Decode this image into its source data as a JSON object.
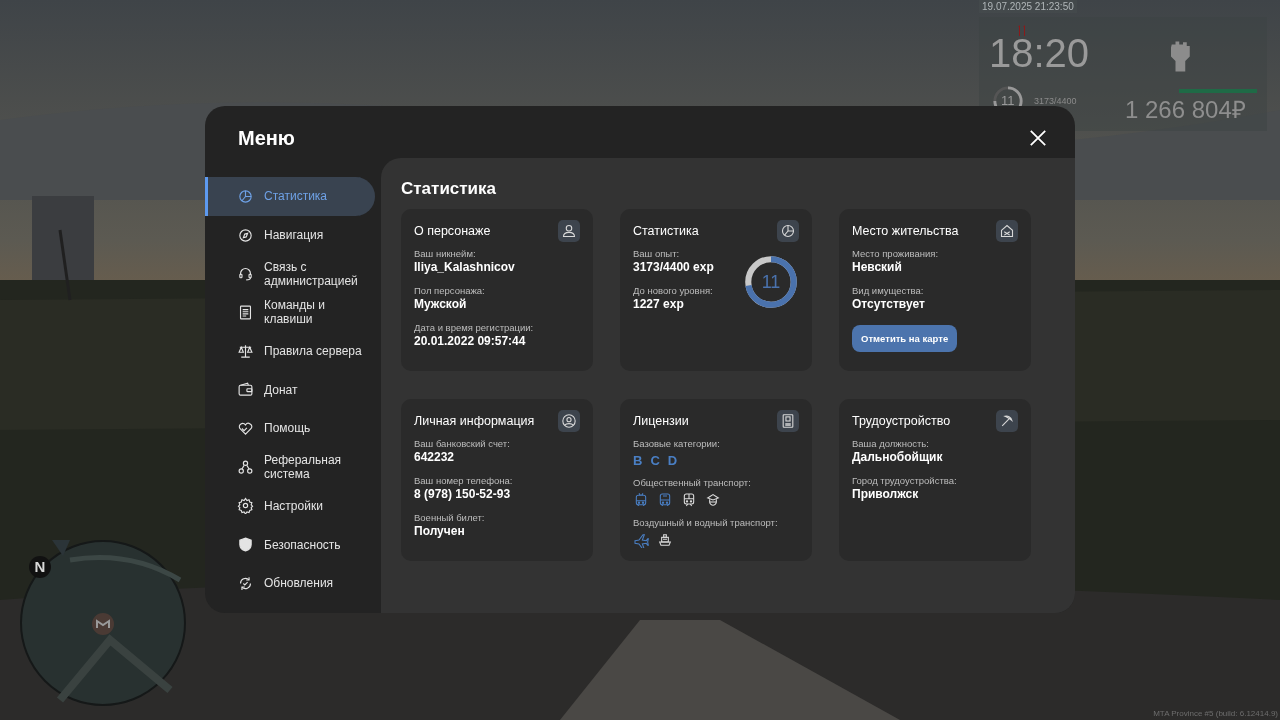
{
  "hud": {
    "timestamp": "19.07.2025 21:23:50",
    "clock": "18:20",
    "level": "11",
    "exp": "3173/4400",
    "health": {
      "level": 1
    },
    "money": "1 266 804₽"
  },
  "minimap": {
    "north": "N"
  },
  "build": "MTA Province #5 (build: 6.12414.9)",
  "menu": {
    "title": "Меню",
    "sidebar": [
      {
        "label": "Статистика",
        "kind": "pie",
        "selected": true
      },
      {
        "label": "Навигация",
        "kind": "compass",
        "selected": false
      },
      {
        "label": "Связь с администрацией",
        "kind": "headset",
        "selected": false
      },
      {
        "label": "Команды и клавиши",
        "kind": "document",
        "selected": false
      },
      {
        "label": "Правила сервера",
        "kind": "scales",
        "selected": false
      },
      {
        "label": "Донат",
        "kind": "wallet",
        "selected": false
      },
      {
        "label": "Помощь",
        "kind": "heart",
        "selected": false
      },
      {
        "label": "Реферальная система",
        "kind": "nodes",
        "selected": false
      },
      {
        "label": "Настройки",
        "kind": "gear",
        "selected": false
      },
      {
        "label": "Безопасность",
        "kind": "shield",
        "selected": false
      },
      {
        "label": "Обновления",
        "kind": "refresh",
        "selected": false
      }
    ],
    "section_title": "Статистика",
    "cards": [
      {
        "title": "О персонаже",
        "kind": "user",
        "fields": [
          {
            "label": "Ваш никнейм:",
            "value": "Iliya_Kalashnicov"
          },
          {
            "label": "Пол персонажа:",
            "value": "Мужской"
          },
          {
            "label": "Дата и время регистрации:",
            "value": "20.01.2022 09:57:44"
          }
        ]
      },
      {
        "title": "Статистика",
        "kind": "pie",
        "fields": [
          {
            "label": "Ваш опыт:",
            "value": "3173/4400 exp"
          },
          {
            "label": "До нового уровня:",
            "value": "1227 exp"
          }
        ],
        "ring": {
          "text": "11",
          "level": 0.72
        }
      },
      {
        "title": "Место жительства",
        "kind": "house",
        "fields": [
          {
            "label": "Место проживания:",
            "value": "Невский"
          },
          {
            "label": "Вид имущества:",
            "value": "Отсутствует"
          }
        ],
        "button": "Отметить на карте"
      },
      {
        "title": "Личная информация",
        "kind": "user-circle",
        "fields": [
          {
            "label": "Ваш банковский счет:",
            "value": "642232"
          },
          {
            "label": "Ваш номер телефона:",
            "value": "8 (978) 150-52-93"
          },
          {
            "label": "Военный билет:",
            "value": "Получен"
          }
        ]
      },
      {
        "title": "Лицензии",
        "kind": "id-card",
        "licenses": [
          {
            "label": "Базовые категории:",
            "kind": "letters",
            "items": [
              {
                "text": "B",
                "held": true
              },
              {
                "text": "C",
                "held": true
              },
              {
                "text": "D",
                "held": true
              }
            ]
          },
          {
            "label": "Общественный транспорт:",
            "kind": "icons",
            "items": [
              {
                "kind": "trolleybus",
                "held": true
              },
              {
                "kind": "bus",
                "held": true
              },
              {
                "kind": "train",
                "held": false
              },
              {
                "kind": "cap",
                "held": false
              }
            ]
          },
          {
            "label": "Воздушный и водный транспорт:",
            "kind": "icons",
            "items": [
              {
                "kind": "plane",
                "held": true
              },
              {
                "kind": "ship",
                "held": false
              }
            ]
          }
        ]
      },
      {
        "title": "Трудоустройство",
        "kind": "pickaxe",
        "fields": [
          {
            "label": "Ваша должность:",
            "value": "Дальнобойщик"
          },
          {
            "label": "Город трудоустройства:",
            "value": "Приволжск"
          }
        ]
      }
    ]
  }
}
